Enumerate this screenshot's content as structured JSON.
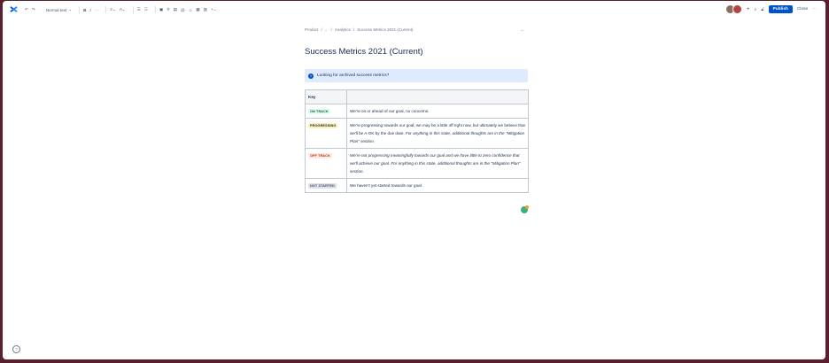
{
  "toolbar": {
    "text_style": "Normal text",
    "publish_label": "Publish",
    "close_label": "Close",
    "more_label": "···",
    "add_label": "+"
  },
  "breadcrumb": {
    "items": [
      "Product",
      "/",
      "...",
      "/",
      "Analytics",
      "/",
      "Success Metrics 2021 (Current)"
    ]
  },
  "page": {
    "title": "Success Metrics 2021 (Current)"
  },
  "info_panel": {
    "text": "Looking for archived success metrics?"
  },
  "key_table": {
    "header": "Key",
    "rows": [
      {
        "status": "ON TRACK",
        "color": "green",
        "text": "We're on or ahead of our goal, no concerns.",
        "italic": ""
      },
      {
        "status": "PROGRESSING",
        "color": "yellow",
        "text": "We're progressing towards our goal; we may be a little off right now, but ultimately we believe that we'll be A-OK by the due date.",
        "italic": "For anything in this state, additional thoughts are in the \"Mitigation Plan\" section."
      },
      {
        "status": "OFF TRACK",
        "color": "red",
        "text": "We're not progressing meaningfully towards our goal and we have little to zero confidence that we'll achieve our goal.",
        "italic": "For anything in this state, additional thoughts are in the \"Mitigation Plan\" section."
      },
      {
        "status": "NOT STARTED",
        "color": "grey",
        "text": "We haven't yet started towards our goal.",
        "italic": ""
      }
    ]
  },
  "colors": {
    "accent": "#0052cc",
    "background": "#5a1f2c"
  }
}
